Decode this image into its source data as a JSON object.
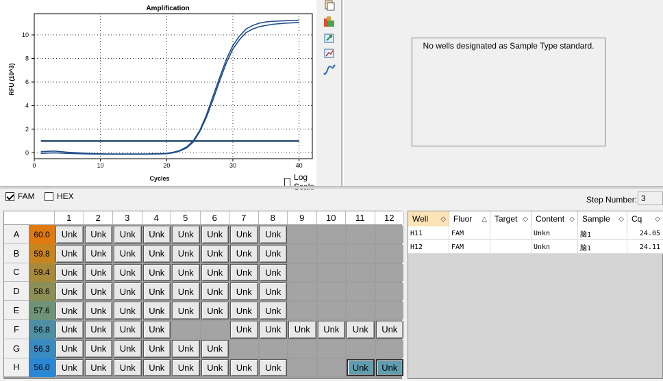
{
  "chart_data": {
    "type": "line",
    "title": "Amplification",
    "xlabel": "Cycles",
    "ylabel": "RFU (10^3)",
    "xlim": [
      0,
      42
    ],
    "ylim": [
      -0.5,
      11.8
    ],
    "x_ticks": [
      0,
      10,
      20,
      30,
      40
    ],
    "y_ticks": [
      0,
      2,
      4,
      6,
      8,
      10
    ],
    "grid": true,
    "threshold": 1.0,
    "series": [
      {
        "x": [
          1,
          3,
          5,
          8,
          11,
          14,
          17,
          20,
          21,
          22,
          23,
          24,
          25,
          26,
          27,
          28,
          29,
          30,
          31,
          32,
          33,
          34,
          35,
          36,
          38,
          40
        ],
        "y": [
          0.1,
          0.15,
          0.05,
          -0.05,
          -0.1,
          -0.1,
          -0.1,
          -0.05,
          0.05,
          0.2,
          0.5,
          1.0,
          1.9,
          3.2,
          4.8,
          6.4,
          7.9,
          9.1,
          9.9,
          10.5,
          10.8,
          11.0,
          11.1,
          11.15,
          11.2,
          11.25
        ]
      },
      {
        "x": [
          1,
          3,
          5,
          8,
          11,
          14,
          17,
          20,
          21,
          22,
          23,
          24,
          25,
          26,
          27,
          28,
          29,
          30,
          31,
          32,
          33,
          34,
          35,
          36,
          38,
          40
        ],
        "y": [
          -0.05,
          0.0,
          -0.05,
          -0.1,
          -0.12,
          -0.12,
          -0.12,
          -0.08,
          0.0,
          0.15,
          0.4,
          0.9,
          1.8,
          3.0,
          4.5,
          6.1,
          7.6,
          8.8,
          9.6,
          10.2,
          10.5,
          10.7,
          10.8,
          10.9,
          11.0,
          11.05
        ]
      }
    ],
    "colors": {
      "line": "#1f4e8c",
      "threshold": "#0a2f5c",
      "grid": "#333333"
    }
  },
  "log_scale": {
    "label": "Log Scale",
    "checked": false
  },
  "toolbar_icons": [
    "copy-icon",
    "export-icon",
    "refresh-icon",
    "chart-settings-icon",
    "curve-icon"
  ],
  "std_curve": {
    "message": "No wells designated as Sample Type standard."
  },
  "fluors": [
    {
      "label": "FAM",
      "checked": true
    },
    {
      "label": "HEX",
      "checked": false
    }
  ],
  "step": {
    "label": "Step Number:",
    "value": "3"
  },
  "plate": {
    "columns": [
      "1",
      "2",
      "3",
      "4",
      "5",
      "6",
      "7",
      "8",
      "9",
      "10",
      "11",
      "12"
    ],
    "rows": [
      {
        "label": "A",
        "temp": "60.0",
        "color": "#e07a10",
        "wells": [
          "Unk",
          "Unk",
          "Unk",
          "Unk",
          "Unk",
          "Unk",
          "Unk",
          "Unk",
          "",
          "",
          "",
          ""
        ]
      },
      {
        "label": "B",
        "temp": "59.8",
        "color": "#c78420",
        "wells": [
          "Unk",
          "Unk",
          "Unk",
          "Unk",
          "Unk",
          "Unk",
          "Unk",
          "Unk",
          "",
          "",
          "",
          ""
        ]
      },
      {
        "label": "C",
        "temp": "59.4",
        "color": "#a88a3a",
        "wells": [
          "Unk",
          "Unk",
          "Unk",
          "Unk",
          "Unk",
          "Unk",
          "Unk",
          "Unk",
          "",
          "",
          "",
          ""
        ]
      },
      {
        "label": "D",
        "temp": "58.6",
        "color": "#8c8f56",
        "wells": [
          "Unk",
          "Unk",
          "Unk",
          "Unk",
          "Unk",
          "Unk",
          "Unk",
          "Unk",
          "",
          "",
          "",
          ""
        ]
      },
      {
        "label": "E",
        "temp": "57.6",
        "color": "#6f9378",
        "wells": [
          "Unk",
          "Unk",
          "Unk",
          "Unk",
          "Unk",
          "Unk",
          "Unk",
          "Unk",
          "",
          "",
          "",
          ""
        ]
      },
      {
        "label": "F",
        "temp": "56.8",
        "color": "#4e8fa4",
        "wells": [
          "Unk",
          "Unk",
          "Unk",
          "Unk",
          "",
          "",
          "Unk",
          "Unk",
          "Unk",
          "Unk",
          "Unk",
          "Unk"
        ]
      },
      {
        "label": "G",
        "temp": "56.3",
        "color": "#3a8cc0",
        "wells": [
          "Unk",
          "Unk",
          "Unk",
          "Unk",
          "Unk",
          "Unk",
          "",
          "",
          "",
          "",
          "",
          ""
        ]
      },
      {
        "label": "H",
        "temp": "56.0",
        "color": "#2a87d6",
        "wells": [
          "Unk",
          "Unk",
          "Unk",
          "Unk",
          "Unk",
          "Unk",
          "Unk",
          "Unk",
          "",
          "",
          "Unk*",
          "Unk*"
        ]
      }
    ]
  },
  "results": {
    "headers": [
      "Well",
      "Fluor",
      "Target",
      "Content",
      "Sample",
      "Cq"
    ],
    "rows": [
      [
        "H11",
        "FAM",
        "",
        "Unkn",
        "脑1",
        "24.05"
      ],
      [
        "H12",
        "FAM",
        "",
        "Unkn",
        "脑1",
        "24.11"
      ]
    ]
  }
}
